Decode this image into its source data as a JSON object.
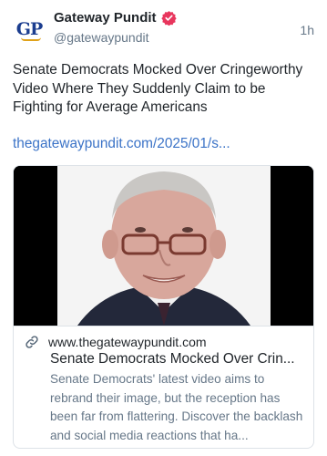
{
  "author": {
    "avatar_text": "GP",
    "display_name": "Gateway Pundit",
    "handle": "@gatewaypundit",
    "verified_icon": "verified-badge-icon",
    "timestamp": "1h"
  },
  "post": {
    "text": "Senate Democrats Mocked Over Cringeworthy Video Where They Suddenly Claim to be Fighting for Average Americans",
    "link_text": "thegatewaypundit.com/2025/01/s..."
  },
  "link_card": {
    "image_description_icon": "photo-icon",
    "link_icon": "link-icon",
    "domain": "www.thegatewaypundit.com",
    "title": "Senate Democrats Mocked Over Crin...",
    "description": "Senate Democrats' latest video aims to rebrand their image, but the reception has been far from flattering. Discover the backlash and social media reactions that ha..."
  },
  "colors": {
    "link": "#3b73c7",
    "muted_text": "#667788",
    "verified": "#e8365d",
    "logo_blue": "#1b3d8f",
    "logo_gold": "#e0a21a"
  }
}
